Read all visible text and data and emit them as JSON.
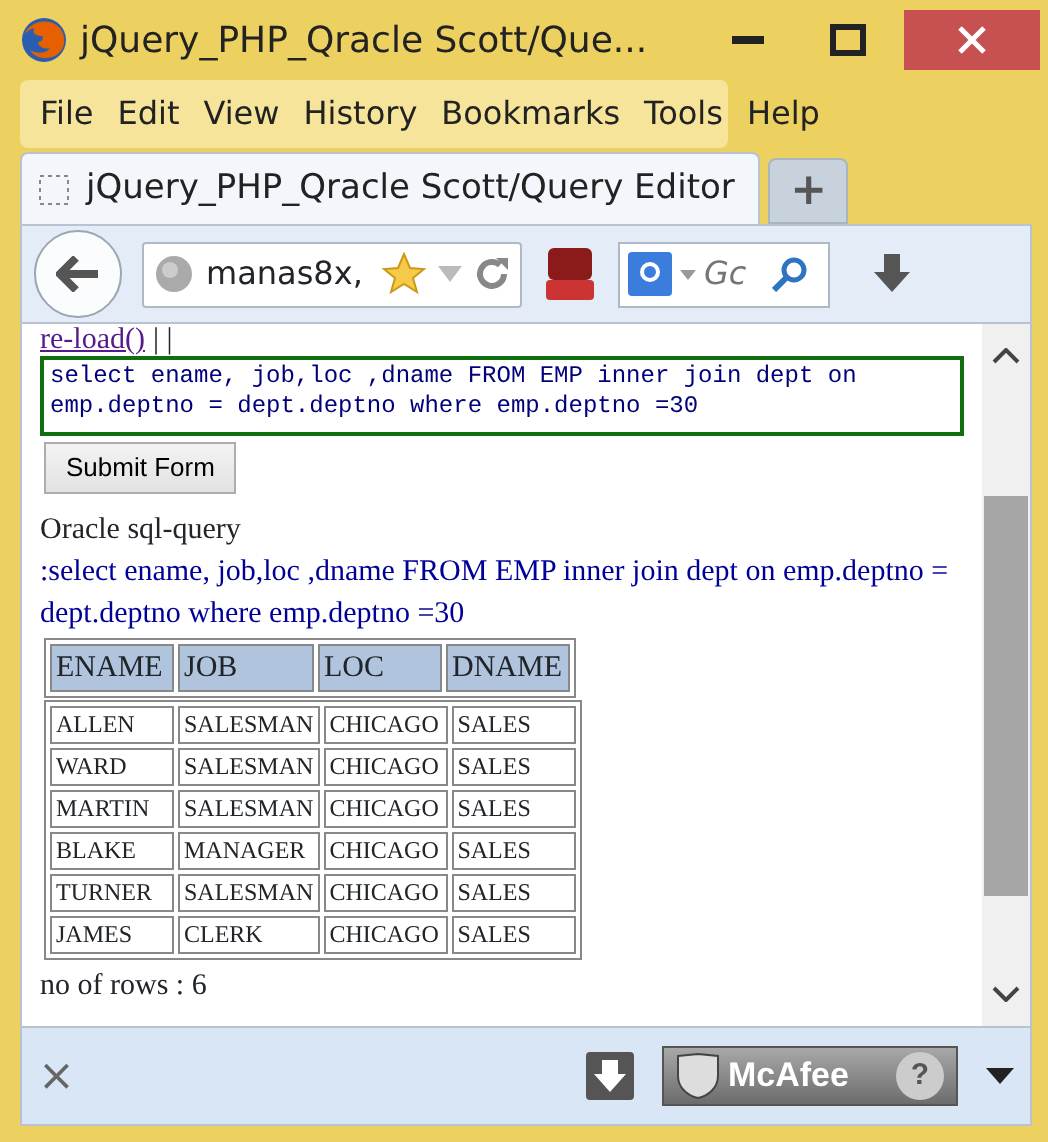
{
  "window": {
    "title": "jQuery_PHP_Qracle Scott/Que..."
  },
  "menu": [
    {
      "label": "File"
    },
    {
      "label": "Edit"
    },
    {
      "label": "View"
    },
    {
      "label": "History"
    },
    {
      "label": "Bookmarks"
    },
    {
      "label": "Tools"
    },
    {
      "label": "Help"
    }
  ],
  "tabs": [
    {
      "label": "jQuery_PHP_Qracle Scott/Query Editor",
      "selected": true
    }
  ],
  "new_tab": "+",
  "address_bar": {
    "value": "manas8x,"
  },
  "search": {
    "placeholder": "Gc"
  },
  "page": {
    "link": "re-load()",
    "separator": "| |",
    "query": "select ename, job,loc ,dname FROM EMP inner join dept on emp.deptno = dept.deptno where emp.deptno =30 ",
    "submit": "Submit Form",
    "heading": "Oracle sql-query",
    "echo": ":select ename, job,loc ,dname FROM EMP inner join dept on emp.deptno = dept.deptno where emp.deptno =30",
    "table": {
      "columns": [
        "ENAME",
        "JOB",
        "LOC",
        "DNAME"
      ],
      "rows": [
        [
          "ALLEN",
          "SALESMAN",
          "CHICAGO",
          "SALES"
        ],
        [
          "WARD",
          "SALESMAN",
          "CHICAGO",
          "SALES"
        ],
        [
          "MARTIN",
          "SALESMAN",
          "CHICAGO",
          "SALES"
        ],
        [
          "BLAKE",
          "MANAGER",
          "CHICAGO",
          "SALES"
        ],
        [
          "TURNER",
          "SALESMAN",
          "CHICAGO",
          "SALES"
        ],
        [
          "JAMES",
          "CLERK",
          "CHICAGO",
          "SALES"
        ]
      ]
    },
    "row_count": "no of rows : 6"
  },
  "addon_bar": {
    "close": "×",
    "mcafee": "McAfee",
    "help": "?"
  }
}
